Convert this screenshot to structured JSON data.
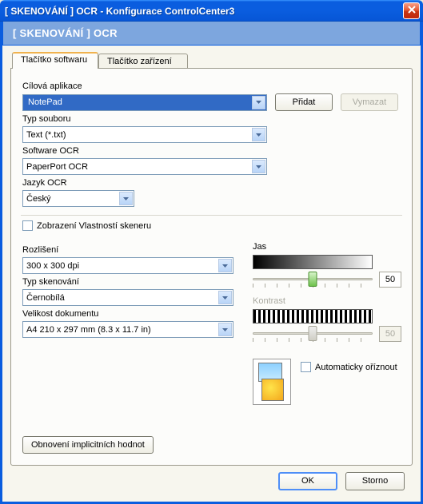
{
  "window": {
    "title": "[  SKENOVÁNÍ  ]   OCR - Konfigurace ControlCenter3",
    "subtitle": "[  SKENOVÁNÍ  ]   OCR"
  },
  "tabs": {
    "software": "Tlačítko softwaru",
    "device": "Tlačítko zařízení"
  },
  "labels": {
    "targetApp": "Cílová aplikace",
    "fileType": "Typ souboru",
    "ocrSoftware": "Software OCR",
    "ocrLanguage": "Jazyk OCR",
    "showScannerProps": "Zobrazení Vlastností skeneru",
    "resolution": "Rozlišení",
    "scanType": "Typ skenování",
    "docSize": "Velikost dokumentu",
    "brightness": "Jas",
    "contrast": "Kontrast",
    "autoCrop": "Automaticky oříznout",
    "restoreDefaults": "Obnovení implicitních hodnot"
  },
  "values": {
    "targetApp": "NotePad",
    "fileType": "Text (*.txt)",
    "ocrSoftware": "PaperPort OCR",
    "ocrLanguage": "Český",
    "resolution": "300 x 300 dpi",
    "scanType": "Černobílá",
    "docSize": "A4 210 x 297 mm (8.3 x 11.7 in)",
    "brightness": "50",
    "contrast": "50"
  },
  "buttons": {
    "add": "Přidat",
    "delete": "Vymazat",
    "ok": "OK",
    "cancel": "Storno"
  }
}
